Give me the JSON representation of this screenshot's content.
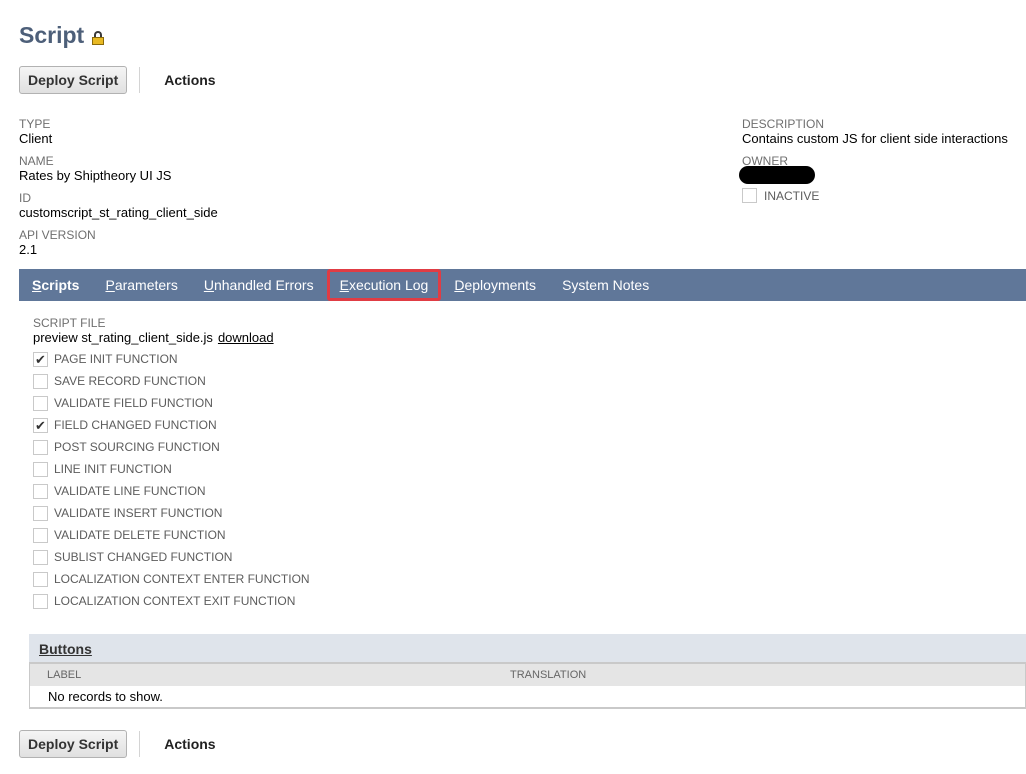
{
  "page": {
    "title": "Script"
  },
  "toolbar": {
    "deploy_label": "Deploy Script",
    "actions_label": "Actions"
  },
  "fields": {
    "type": {
      "label": "TYPE",
      "value": "Client"
    },
    "name": {
      "label": "NAME",
      "value": "Rates by Shiptheory UI JS"
    },
    "id": {
      "label": "ID",
      "value": "customscript_st_rating_client_side"
    },
    "api_version": {
      "label": "API VERSION",
      "value": "2.1"
    },
    "description": {
      "label": "DESCRIPTION",
      "value": "Contains custom JS for client side interactions"
    },
    "owner": {
      "label": "OWNER"
    },
    "inactive": {
      "label": "INACTIVE",
      "checked": false
    }
  },
  "tabs": [
    {
      "first": "S",
      "rest": "cripts",
      "active": true
    },
    {
      "first": "P",
      "rest": "arameters"
    },
    {
      "first": "U",
      "rest": "nhandled Errors"
    },
    {
      "first": "E",
      "rest": "xecution Log",
      "highlighted": true
    },
    {
      "first": "D",
      "rest": "eployments"
    },
    {
      "first": "",
      "rest": "System Notes"
    }
  ],
  "script_file": {
    "label": "SCRIPT FILE",
    "preview_text": "preview st_rating_client_side.js",
    "download_label": "download"
  },
  "functions": [
    {
      "label": "PAGE INIT FUNCTION",
      "checked": true,
      "mark": "✔"
    },
    {
      "label": "SAVE RECORD FUNCTION",
      "checked": false,
      "mark": ""
    },
    {
      "label": "VALIDATE FIELD FUNCTION",
      "checked": false,
      "mark": ""
    },
    {
      "label": "FIELD CHANGED FUNCTION",
      "checked": true,
      "mark": "✔"
    },
    {
      "label": "POST SOURCING FUNCTION",
      "checked": false,
      "mark": ""
    },
    {
      "label": "LINE INIT FUNCTION",
      "checked": false,
      "mark": ""
    },
    {
      "label": "VALIDATE LINE FUNCTION",
      "checked": false,
      "mark": ""
    },
    {
      "label": "VALIDATE INSERT FUNCTION",
      "checked": false,
      "mark": ""
    },
    {
      "label": "VALIDATE DELETE FUNCTION",
      "checked": false,
      "mark": ""
    },
    {
      "label": "SUBLIST CHANGED FUNCTION",
      "checked": false,
      "mark": ""
    },
    {
      "label": "LOCALIZATION CONTEXT ENTER FUNCTION",
      "checked": false,
      "mark": ""
    },
    {
      "label": "LOCALIZATION CONTEXT EXIT FUNCTION",
      "checked": false,
      "mark": ""
    }
  ],
  "buttons_sublist": {
    "tab_first": "B",
    "tab_rest": "uttons",
    "columns": [
      "LABEL",
      "TRANSLATION"
    ],
    "empty_text": "No records to show."
  },
  "colors": {
    "tabbar": "#607799",
    "highlight": "#e03c44",
    "title": "#4d5f79"
  }
}
